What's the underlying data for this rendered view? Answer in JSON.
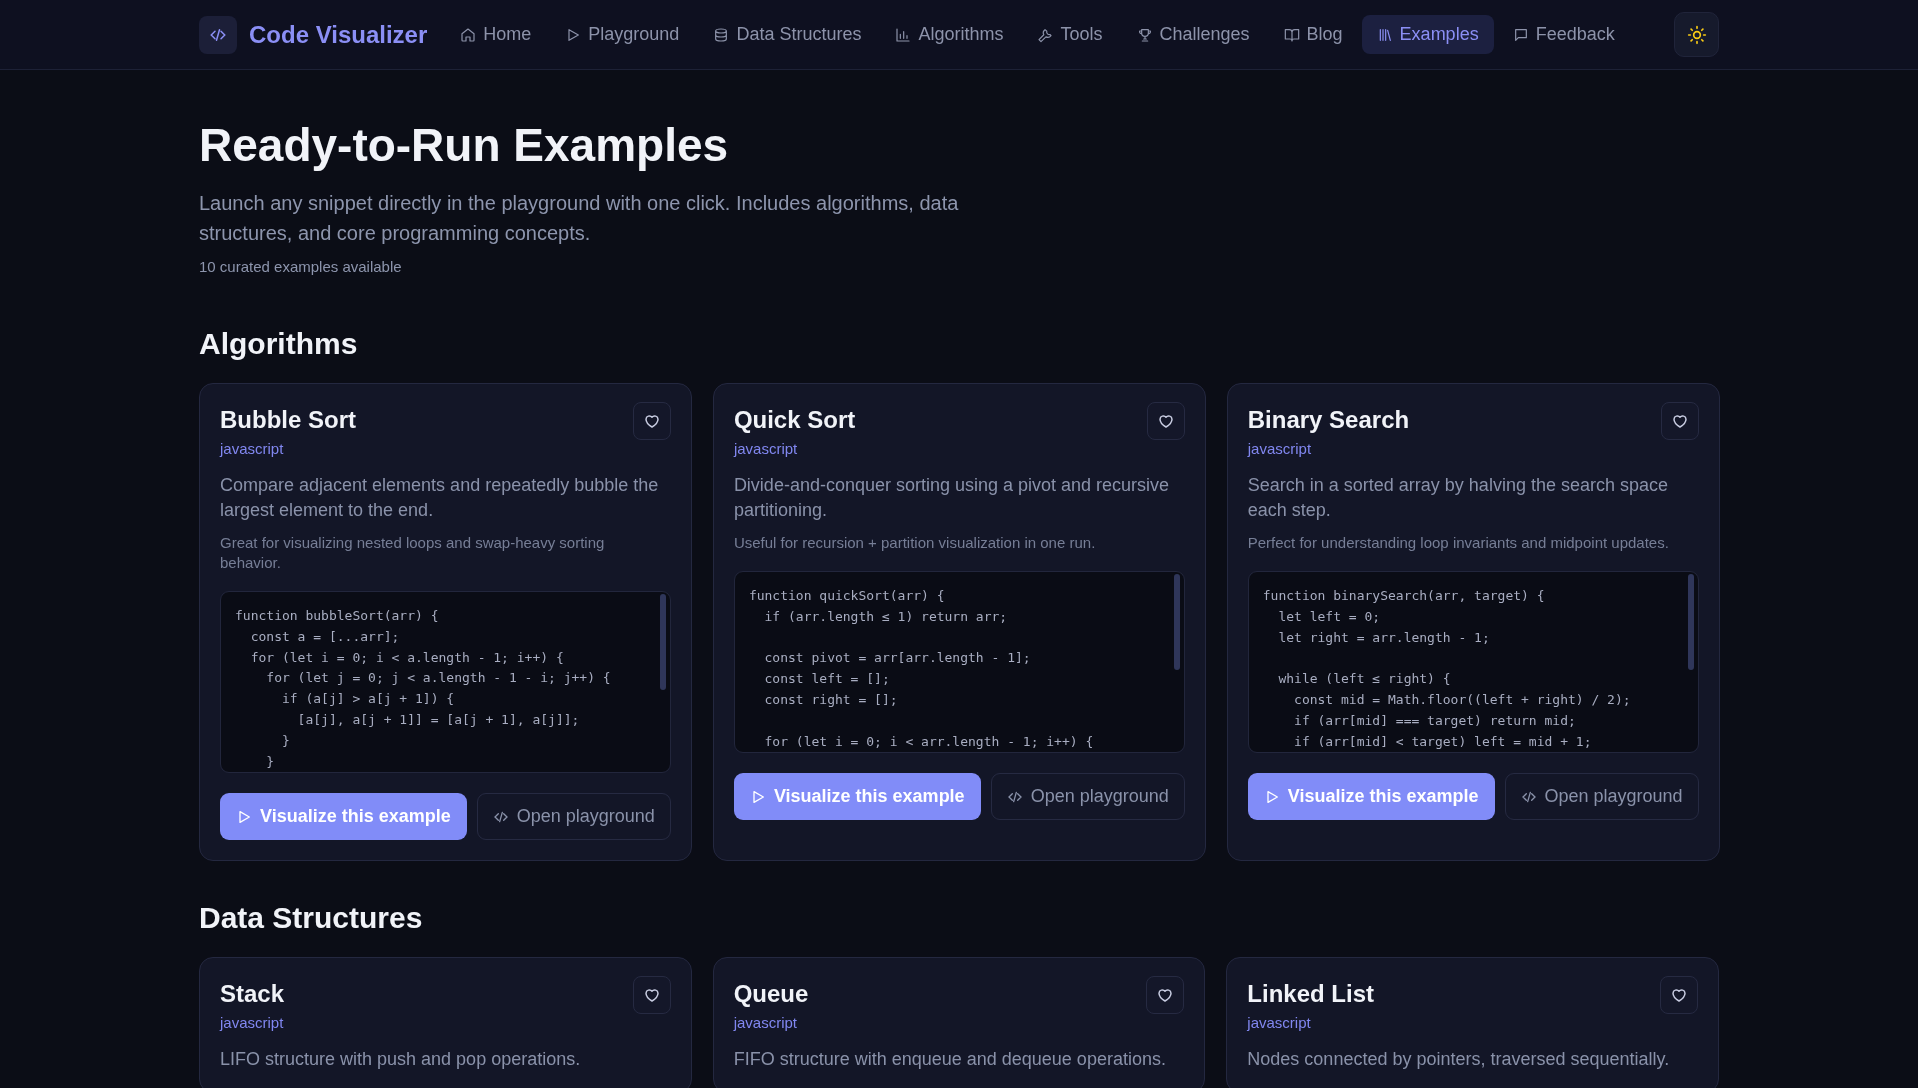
{
  "nav": {
    "logo": "Code Visualizer",
    "items": [
      {
        "label": "Home",
        "selected": false
      },
      {
        "label": "Playground",
        "selected": false
      },
      {
        "label": "Data Structures",
        "selected": false
      },
      {
        "label": "Algorithms",
        "selected": false
      },
      {
        "label": "Tools",
        "selected": false
      },
      {
        "label": "Challenges",
        "selected": false
      },
      {
        "label": "Blog",
        "selected": false
      },
      {
        "label": "Examples",
        "selected": true
      },
      {
        "label": "Feedback",
        "selected": false
      }
    ]
  },
  "header": {
    "title": "Ready-to-Run Examples",
    "subtitle": "Launch any snippet directly in the playground with one click. Includes algorithms, data structures, and core programming concepts.",
    "count": "10 curated examples available"
  },
  "sections": [
    {
      "title": "Algorithms",
      "cards": [
        {
          "title": "Bubble Sort",
          "language": "javascript",
          "description": "Compare adjacent elements and repeatedly bubble the largest element to the end.",
          "note": "Great for visualizing nested loops and swap-heavy sorting behavior.",
          "code": "function bubbleSort(arr) {\n  const a = [...arr];\n  for (let i = 0; i < a.length - 1; i++) {\n    for (let j = 0; j < a.length - 1 - i; j++) {\n      if (a[j] > a[j + 1]) {\n        [a[j], a[j + 1]] = [a[j + 1], a[j]];\n      }\n    }",
          "primary": "Visualize this example",
          "secondary": "Open playground"
        },
        {
          "title": "Quick Sort",
          "language": "javascript",
          "description": "Divide-and-conquer sorting using a pivot and recursive partitioning.",
          "note": "Useful for recursion + partition visualization in one run.",
          "code": "function quickSort(arr) {\n  if (arr.length ≤ 1) return arr;\n\n  const pivot = arr[arr.length - 1];\n  const left = [];\n  const right = [];\n\n  for (let i = 0; i < arr.length - 1; i++) {",
          "primary": "Visualize this example",
          "secondary": "Open playground"
        },
        {
          "title": "Binary Search",
          "language": "javascript",
          "description": "Search in a sorted array by halving the search space each step.",
          "note": "Perfect for understanding loop invariants and midpoint updates.",
          "code": "function binarySearch(arr, target) {\n  let left = 0;\n  let right = arr.length - 1;\n\n  while (left ≤ right) {\n    const mid = Math.floor((left + right) / 2);\n    if (arr[mid] === target) return mid;\n    if (arr[mid] < target) left = mid + 1;",
          "primary": "Visualize this example",
          "secondary": "Open playground"
        }
      ]
    },
    {
      "title": "Data Structures",
      "cards": [
        {
          "title": "Stack",
          "language": "javascript",
          "description": "LIFO structure with push and pop operations."
        },
        {
          "title": "Queue",
          "language": "javascript",
          "description": "FIFO structure with enqueue and dequeue operations."
        },
        {
          "title": "Linked List",
          "language": "javascript",
          "description": "Nodes connected by pointers, traversed sequentially."
        }
      ]
    }
  ]
}
